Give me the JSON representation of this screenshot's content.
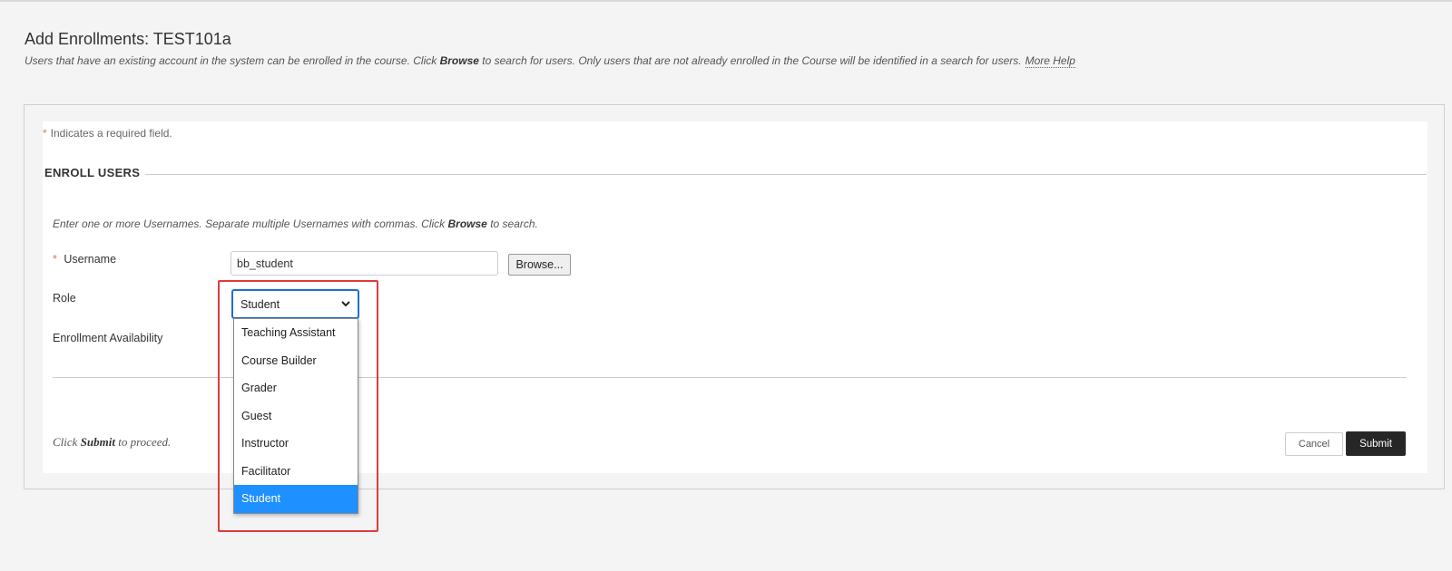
{
  "page": {
    "title": "Add Enrollments: TEST101a",
    "instructions_part1": "Users that have an existing account in the system can be enrolled in the course. Click ",
    "instructions_bold": "Browse",
    "instructions_part2": " to search for users. Only users that are not already enrolled in the Course will be identified in a search for users.",
    "help_link": "More Help"
  },
  "form": {
    "required_star": "*",
    "required_note": "Indicates a required field.",
    "section_title": "ENROLL USERS",
    "enroll_instr_part1": "Enter one or more Usernames. Separate multiple Usernames with commas. Click ",
    "enroll_instr_bold": "Browse",
    "enroll_instr_part2": " to search.",
    "username_label": "Username",
    "username_value": "bb_student",
    "browse_label": "Browse...",
    "role_label": "Role",
    "role_selected": "Student",
    "role_options": [
      "Teaching Assistant",
      "Course Builder",
      "Grader",
      "Guest",
      "Instructor",
      "Facilitator",
      "Student"
    ],
    "availability_label": "Enrollment Availability",
    "submit_instr_part1": "Click ",
    "submit_instr_bold": "Submit",
    "submit_instr_part2": " to proceed.",
    "cancel_label": "Cancel",
    "submit_label": "Submit"
  },
  "colors": {
    "accent_required": "#e87722",
    "select_focus": "#1f6fd0",
    "option_highlight": "#1e90ff",
    "annotation_box": "#e03b3b",
    "submit_bg": "#262626"
  },
  "icons": {
    "dropdown": "chevron-down-icon"
  }
}
